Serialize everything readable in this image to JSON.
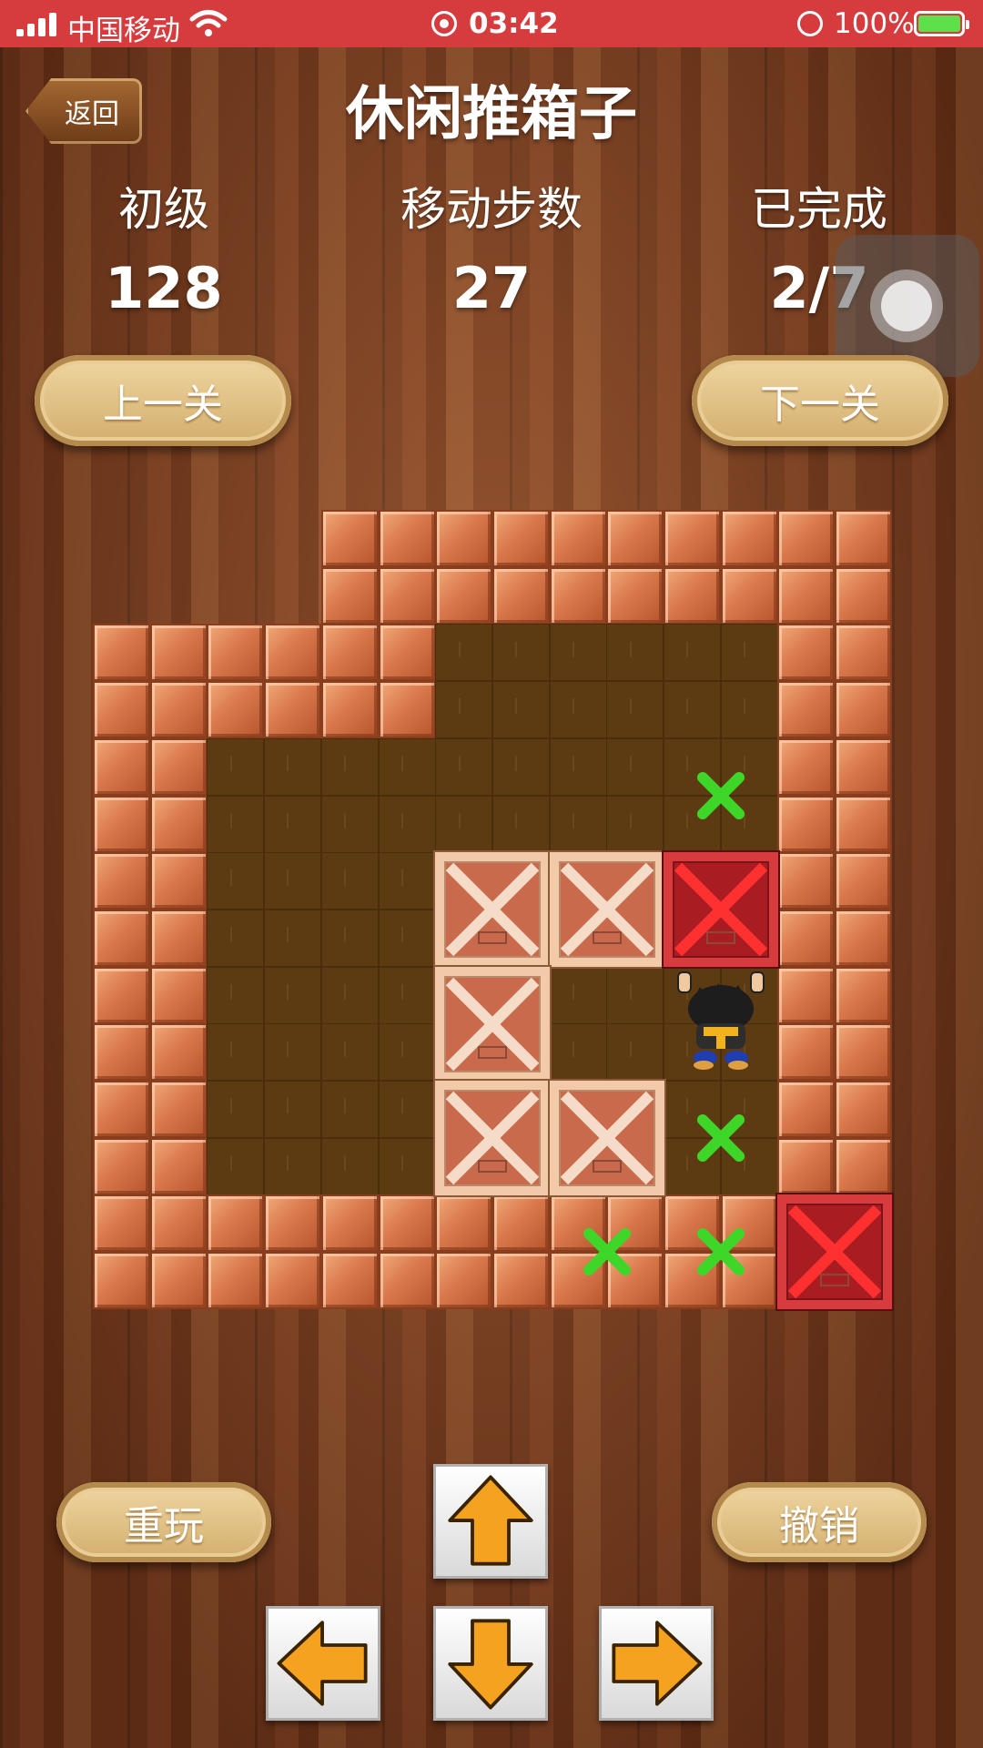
{
  "status_bar": {
    "carrier": "中国移动",
    "time": "03:42",
    "battery": "100%"
  },
  "header": {
    "back_label": "返回",
    "title": "休闲推箱子"
  },
  "stats": {
    "level_label": "初级",
    "level_value": "128",
    "moves_label": "移动步数",
    "moves_value": "27",
    "completed_label": "已完成",
    "completed_value": "2/7"
  },
  "nav": {
    "prev_label": "上一关",
    "next_label": "下一关"
  },
  "controls": {
    "replay_label": "重玩",
    "undo_label": "撤销",
    "up_icon": "arrow-up-icon",
    "down_icon": "arrow-down-icon",
    "left_icon": "arrow-left-icon",
    "right_icon": "arrow-right-icon"
  },
  "game": {
    "grid_cols": 14,
    "grid_rows": 14,
    "map": [
      "....WWWWWWWWWW",
      "....WWWWWWWWWW",
      "WWWWWWFFFFFFWW",
      "WWWWWWFFFFFFWW",
      "WWFFFFFFFFFFWW",
      "WWFFFFFFFFFFWW",
      "WWFFFFFFFFFFWW",
      "WWFFFFFFFFFFWW",
      "WWFFFFFFFFFFWW",
      "WWFFFFFFFFFFWW",
      "WWFFFFFFFFFFWW",
      "WWFFFFFFFFFFWW",
      "WWWWWWWWWWWWWW",
      "WWWWWWWWWWWWWW"
    ],
    "boxes": [
      {
        "col": 2,
        "row": 2,
        "on_target": false
      },
      {
        "col": 3,
        "row": 2,
        "on_target": false
      },
      {
        "col": 4,
        "row": 2,
        "on_target": true
      },
      {
        "col": 2,
        "row": 3,
        "on_target": false
      },
      {
        "col": 2,
        "row": 4,
        "on_target": false
      },
      {
        "col": 3,
        "row": 4,
        "on_target": false
      },
      {
        "col": 5,
        "row": 5,
        "on_target": true
      }
    ],
    "targets": [
      {
        "col": 4,
        "row": 1
      },
      {
        "col": 4,
        "row": 4
      },
      {
        "col": 3,
        "row": 5
      },
      {
        "col": 4,
        "row": 5
      }
    ],
    "player": {
      "col": 4,
      "row": 3
    },
    "colors": {
      "target": "#3fd62a",
      "box_cross": "#f5dcc8",
      "box_done_cross": "#ff3030"
    }
  }
}
